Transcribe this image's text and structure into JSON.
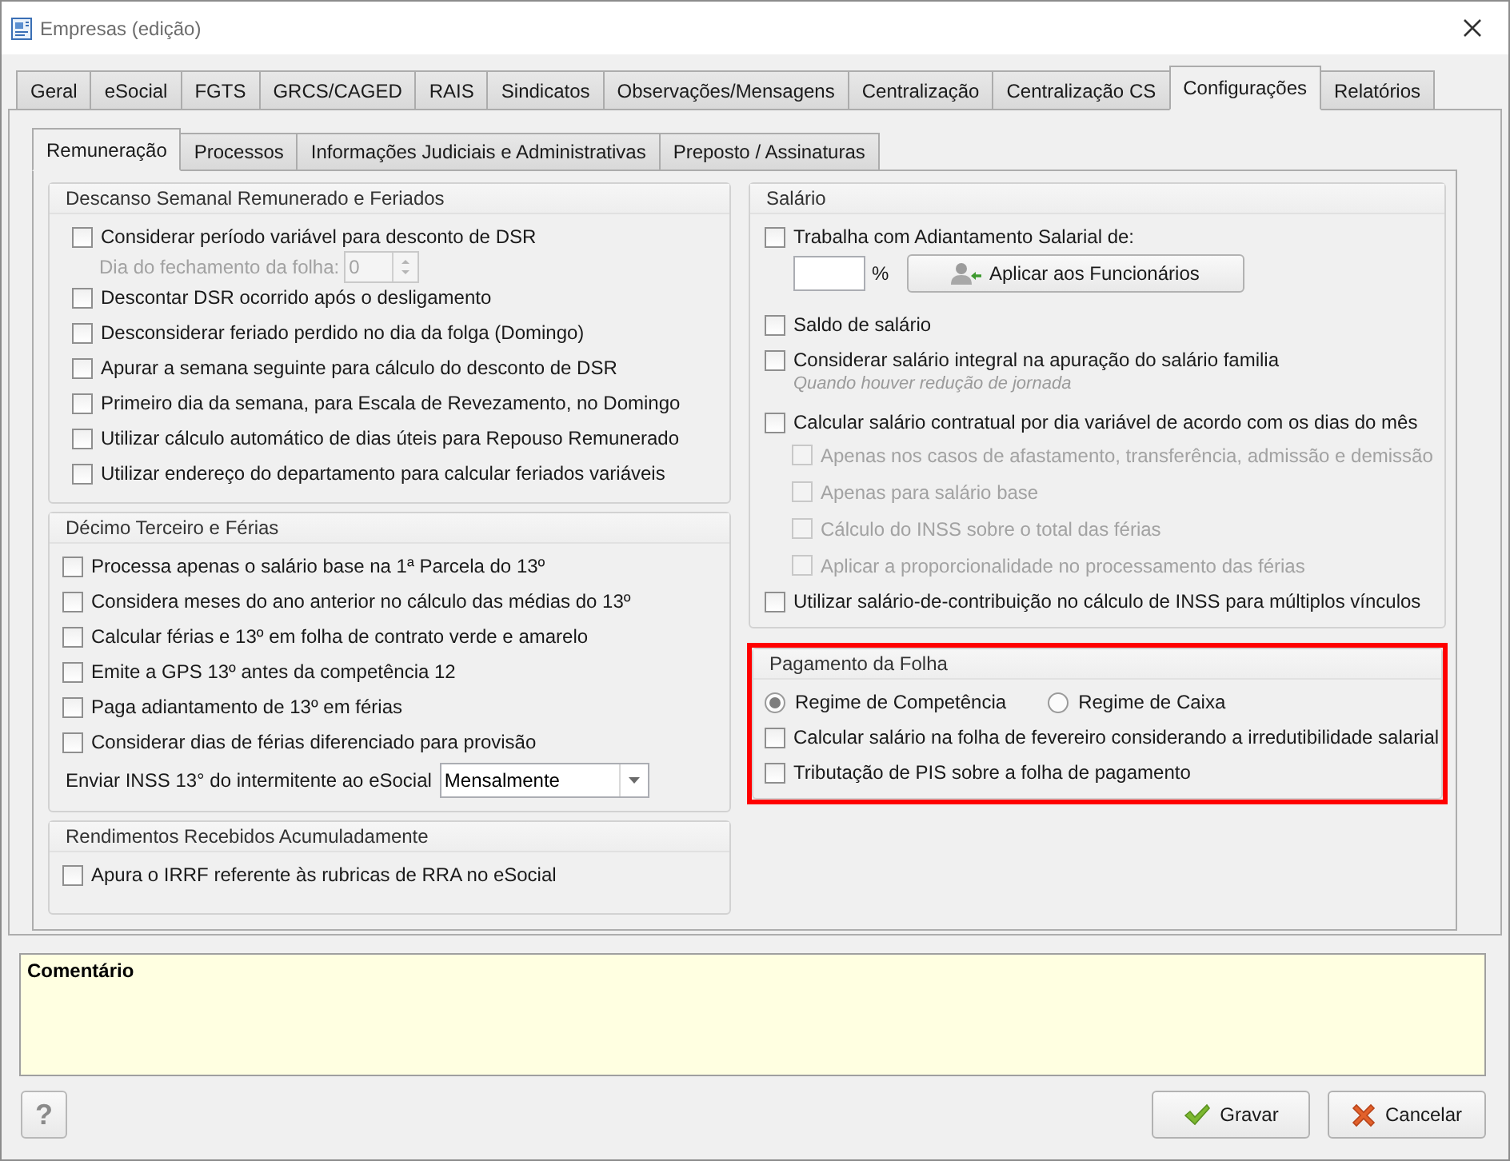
{
  "window": {
    "title": "Empresas (edição)"
  },
  "tabs": [
    {
      "label": "Geral",
      "selected": false
    },
    {
      "label": "eSocial",
      "selected": false
    },
    {
      "label": "FGTS",
      "selected": false
    },
    {
      "label": "GRCS/CAGED",
      "selected": false
    },
    {
      "label": "RAIS",
      "selected": false
    },
    {
      "label": "Sindicatos",
      "selected": false
    },
    {
      "label": "Observações/Mensagens",
      "selected": false
    },
    {
      "label": "Centralização",
      "selected": false
    },
    {
      "label": "Centralização CS",
      "selected": false
    },
    {
      "label": "Configurações",
      "selected": true
    },
    {
      "label": "Relatórios",
      "selected": false
    }
  ],
  "subtabs": [
    {
      "label": "Remuneração",
      "selected": true
    },
    {
      "label": "Processos",
      "selected": false
    },
    {
      "label": "Informações Judiciais e Administrativas",
      "selected": false
    },
    {
      "label": "Preposto / Assinaturas",
      "selected": false
    }
  ],
  "left_groups": [
    {
      "title": "Descanso Semanal Remunerado e Feriados",
      "highlighted": false,
      "items": [
        {
          "kind": "checkbox",
          "label": "Considerar período variável para desconto de DSR",
          "checked": false,
          "children": [
            {
              "kind": "spinner",
              "label": "Dia do fechamento da folha:",
              "value": "0",
              "disabled": true
            }
          ]
        },
        {
          "kind": "checkbox",
          "label": "Descontar DSR ocorrido após o desligamento",
          "checked": false
        },
        {
          "kind": "checkbox",
          "label": "Desconsiderar feriado perdido no dia da folga (Domingo)",
          "checked": false
        },
        {
          "kind": "checkbox",
          "label": "Apurar a semana seguinte para cálculo do desconto de DSR",
          "checked": false
        },
        {
          "kind": "checkbox",
          "label": "Primeiro dia da semana, para Escala de Revezamento, no Domingo",
          "checked": false
        },
        {
          "kind": "checkbox",
          "label": "Utilizar cálculo automático de dias úteis para Repouso Remunerado",
          "checked": false
        },
        {
          "kind": "checkbox",
          "label": "Utilizar endereço do departamento para calcular feriados variáveis",
          "checked": false
        }
      ]
    },
    {
      "title": "Décimo Terceiro e Férias",
      "highlighted": false,
      "items": [
        {
          "kind": "checkbox",
          "label": "Processa apenas o salário base na 1ª Parcela do 13º",
          "checked": false
        },
        {
          "kind": "checkbox",
          "label": "Considera meses do ano anterior no cálculo das médias do 13º",
          "checked": false
        },
        {
          "kind": "checkbox",
          "label": "Calcular férias e 13º em folha de contrato verde e amarelo",
          "checked": false
        },
        {
          "kind": "checkbox",
          "label": "Emite a GPS 13º antes da competência 12",
          "checked": false
        },
        {
          "kind": "checkbox",
          "label": "Paga adiantamento de 13º em férias",
          "checked": false
        },
        {
          "kind": "checkbox",
          "label": "Considerar dias de férias diferenciado para provisão",
          "checked": false
        },
        {
          "kind": "select",
          "label": "Enviar INSS 13° do intermitente ao eSocial",
          "value": "Mensalmente"
        }
      ]
    },
    {
      "title": "Rendimentos Recebidos Acumuladamente",
      "highlighted": false,
      "items": [
        {
          "kind": "checkbox",
          "label": "Apura o IRRF referente às rubricas de RRA no eSocial",
          "checked": false
        }
      ]
    }
  ],
  "right_groups": [
    {
      "title": "Salário",
      "highlighted": false,
      "items": [
        {
          "kind": "checkbox",
          "label": "Trabalha com Adiantamento Salarial de:",
          "checked": false
        },
        {
          "kind": "percent",
          "unit": "%",
          "button": "Aplicar aos Funcionários"
        },
        {
          "kind": "checkbox",
          "label": "Saldo de salário",
          "checked": false
        },
        {
          "kind": "checkbox",
          "label": "Considerar salário integral na apuração do salário familia",
          "checked": false,
          "hint": "Quando houver redução de jornada"
        },
        {
          "kind": "checkbox",
          "label": "Calcular salário contratual por dia variável de acordo com os dias do mês",
          "checked": false,
          "children": [
            {
              "kind": "checkbox",
              "label": "Apenas nos casos de afastamento, transferência, admissão e demissão",
              "checked": false,
              "disabled": true
            },
            {
              "kind": "checkbox",
              "label": "Apenas para salário base",
              "checked": false,
              "disabled": true
            },
            {
              "kind": "checkbox",
              "label": "Cálculo do INSS sobre o total das férias",
              "checked": false,
              "disabled": true
            },
            {
              "kind": "checkbox",
              "label": "Aplicar a proporcionalidade no processamento das férias",
              "checked": false,
              "disabled": true
            }
          ]
        },
        {
          "kind": "checkbox",
          "label": "Utilizar salário-de-contribuição no cálculo de INSS para múltiplos vínculos",
          "checked": false
        }
      ]
    },
    {
      "title": "Pagamento da Folha",
      "highlighted": true,
      "items": [
        {
          "kind": "radio_group",
          "options": [
            {
              "label": "Regime de Competência",
              "selected": true
            },
            {
              "label": "Regime de Caixa",
              "selected": false
            }
          ]
        },
        {
          "kind": "checkbox",
          "label": "Calcular salário na folha de fevereiro considerando a irredutibilidade salarial",
          "checked": false
        },
        {
          "kind": "checkbox",
          "label": "Tributação de PIS sobre a folha de pagamento",
          "checked": false
        }
      ]
    }
  ],
  "comment": {
    "label": "Comentário"
  },
  "footer": {
    "help": "?",
    "actions": [
      {
        "kind": "save",
        "label": "Gravar"
      },
      {
        "kind": "cancel",
        "label": "Cancelar"
      }
    ]
  }
}
